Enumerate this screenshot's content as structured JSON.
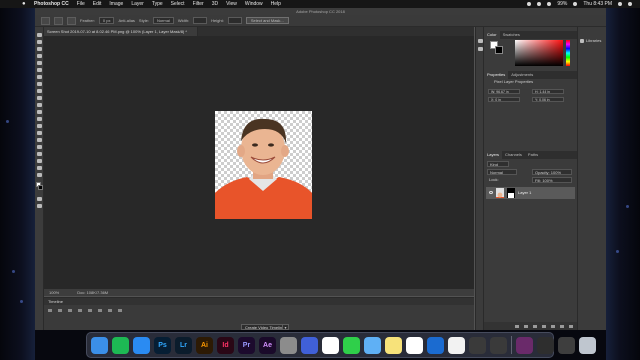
{
  "menubar": {
    "app_name": "Photoshop CC",
    "items": [
      "File",
      "Edit",
      "Image",
      "Layer",
      "Type",
      "Select",
      "Filter",
      "3D",
      "View",
      "Window",
      "Help"
    ],
    "status": {
      "battery": "99%",
      "clock": "Thu 8:43 PM"
    }
  },
  "window": {
    "title": "Adobe Photoshop CC 2018"
  },
  "options_bar": {
    "feather_label": "Feather:",
    "feather_value": "0 px",
    "antialias_label": "Anti-alias",
    "style_label": "Style:",
    "style_value": "Normal",
    "width_label": "Width:",
    "height_label": "Height:",
    "select_mask_button": "Select and Mask..."
  },
  "document": {
    "tab_title": "Screen Shot 2019-07-10 at 8.02.46 PM.png @ 100% (Layer 1, Layer Mask/8) *"
  },
  "statusbar": {
    "zoom": "100%",
    "doc_size": "Doc: 108K/7.36M"
  },
  "timeline": {
    "title": "Timeline",
    "create_button": "Create Video Timeline"
  },
  "color_panel": {
    "tabs": [
      "Color",
      "Swatches"
    ],
    "foreground": "#ffffff",
    "background": "#000000"
  },
  "properties_panel": {
    "tabs": [
      "Properties",
      "Adjustments"
    ],
    "layer_type": "Pixel Layer Properties",
    "w_value": "W: 96.67 in",
    "h_value": "H: 1.44 in",
    "x_value": "X: 0 in",
    "y_value": "Y: 0.06 in"
  },
  "layers_panel": {
    "tabs": [
      "Layers",
      "Channels",
      "Paths"
    ],
    "kind_filter": "Kind",
    "blend_mode": "Normal",
    "opacity": "Opacity: 100%",
    "lock_label": "Lock:",
    "fill": "Fill: 100%",
    "layers": [
      {
        "name": "Layer 1"
      }
    ]
  },
  "libraries": {
    "label": "Libraries"
  },
  "dock": {
    "apps": [
      {
        "name": "finder-icon",
        "label": "",
        "bg": "#3b8fe8",
        "fg": "#ffffff"
      },
      {
        "name": "spotify-icon",
        "label": "",
        "bg": "#1db954",
        "fg": "#0b0b0b"
      },
      {
        "name": "safari-icon",
        "label": "",
        "bg": "#2a8bf2",
        "fg": "#ffffff"
      },
      {
        "name": "photoshop-icon",
        "label": "Ps",
        "bg": "#061e34",
        "fg": "#31a8ff"
      },
      {
        "name": "lightroom-icon",
        "label": "Lr",
        "bg": "#0b1c2c",
        "fg": "#31a8ff"
      },
      {
        "name": "illustrator-icon",
        "label": "Ai",
        "bg": "#2d1a04",
        "fg": "#ff9a00"
      },
      {
        "name": "indesign-icon",
        "label": "Id",
        "bg": "#2a0716",
        "fg": "#ff3366"
      },
      {
        "name": "premiere-icon",
        "label": "Pr",
        "bg": "#1c0a2d",
        "fg": "#9999ff"
      },
      {
        "name": "after-effects-icon",
        "label": "Ae",
        "bg": "#1a0a2a",
        "fg": "#d291ff"
      },
      {
        "name": "system-preferences-icon",
        "label": "",
        "bg": "#8c8c8c",
        "fg": "#ffffff"
      },
      {
        "name": "timing-icon",
        "label": "",
        "bg": "#4060d8",
        "fg": "#ffffff"
      },
      {
        "name": "slack-icon",
        "label": "",
        "bg": "#ffffff",
        "fg": "#4a154b"
      },
      {
        "name": "messages-icon",
        "label": "",
        "bg": "#2fcf4a",
        "fg": "#ffffff"
      },
      {
        "name": "finder-face-icon",
        "label": "",
        "bg": "#5fb0f5",
        "fg": "#ffffff"
      },
      {
        "name": "notes-icon",
        "label": "",
        "bg": "#f7e27a",
        "fg": "#333333"
      },
      {
        "name": "photos-icon",
        "label": "",
        "bg": "#ffffff",
        "fg": "#e03a3a"
      },
      {
        "name": "edge-icon",
        "label": "",
        "bg": "#1b6bd0",
        "fg": "#ffffff"
      },
      {
        "name": "blank-doc-icon",
        "label": "",
        "bg": "#f2f2f2",
        "fg": "#333333"
      },
      {
        "name": "screenshot-icon",
        "label": "",
        "bg": "#3a3a3a",
        "fg": "#e0e0e0"
      },
      {
        "name": "screenshot-icon-2",
        "label": "",
        "bg": "#3a3a3a",
        "fg": "#e0e0e0"
      },
      {
        "name": "premiere-thumb-icon",
        "label": "",
        "bg": "#6a2a6a",
        "fg": "#ffffff"
      },
      {
        "name": "screenshot-icon-3",
        "label": "",
        "bg": "#2e2e2e",
        "fg": "#e0e0e0"
      },
      {
        "name": "screenshot-icon-4",
        "label": "",
        "bg": "#3e3e3e",
        "fg": "#e0e0e0"
      },
      {
        "name": "trash-icon",
        "label": "",
        "bg": "#bfc6cf",
        "fg": "#333333"
      }
    ]
  }
}
